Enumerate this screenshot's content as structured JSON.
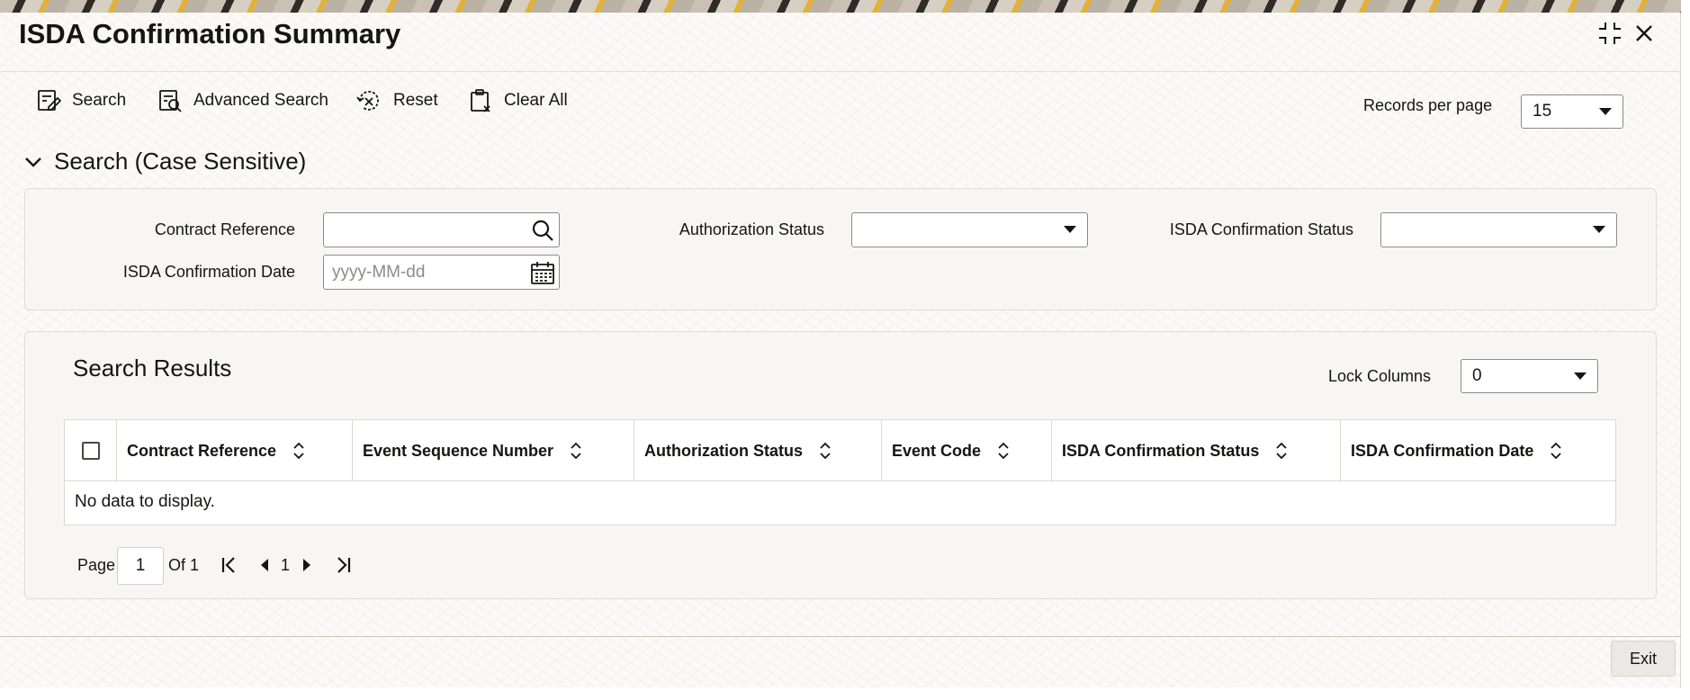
{
  "window": {
    "title": "ISDA Confirmation Summary"
  },
  "toolbar": {
    "search_label": "Search",
    "advanced_search_label": "Advanced Search",
    "reset_label": "Reset",
    "clear_all_label": "Clear All",
    "records_per_page_label": "Records per page",
    "records_per_page_value": "15"
  },
  "criteria": {
    "section_title": "Search (Case Sensitive)",
    "contract_reference_label": "Contract Reference",
    "contract_reference_value": "",
    "authorization_status_label": "Authorization Status",
    "authorization_status_value": "",
    "isda_confirmation_status_label": "ISDA Confirmation Status",
    "isda_confirmation_status_value": "",
    "isda_confirmation_date_label": "ISDA Confirmation Date",
    "isda_confirmation_date_placeholder": "yyyy-MM-dd"
  },
  "results": {
    "title": "Search Results",
    "lock_columns_label": "Lock Columns",
    "lock_columns_value": "0",
    "columns": [
      "Contract Reference",
      "Event Sequence Number",
      "Authorization Status",
      "Event Code",
      "ISDA Confirmation Status",
      "ISDA Confirmation Date"
    ],
    "rows": [],
    "empty_message": "No data to display."
  },
  "pagination": {
    "page_label": "Page",
    "current_page": "1",
    "of_label": "Of 1",
    "page_number": "1"
  },
  "footer": {
    "exit_label": "Exit"
  },
  "icons": {
    "collapse": "collapse-icon",
    "close": "close-icon",
    "search": "search-icon",
    "advanced_search": "advanced-search-icon",
    "reset": "reset-icon",
    "clear_all": "clear-all-icon",
    "calendar": "calendar-icon",
    "sort": "sort-icon"
  }
}
